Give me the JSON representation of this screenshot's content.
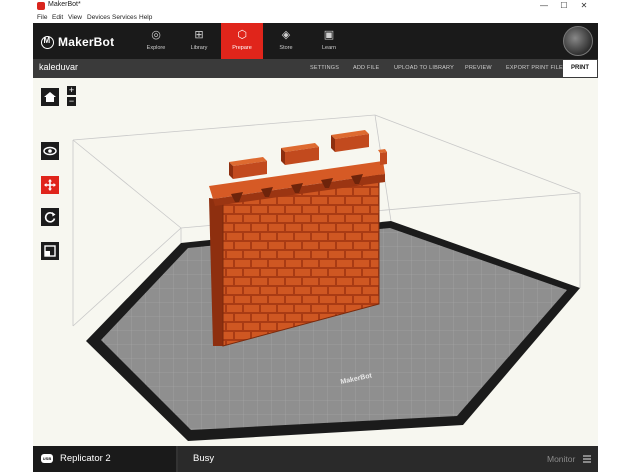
{
  "window": {
    "title": "MakerBot*",
    "controls": [
      "—",
      "☐",
      "✕"
    ]
  },
  "menu": [
    "File",
    "Edit",
    "View",
    "Devices",
    "Services",
    "Help"
  ],
  "nav": {
    "brand": "MakerBot",
    "tabs": [
      {
        "label": "Explore",
        "icon": "compass-icon",
        "glyph": "◎",
        "active": false
      },
      {
        "label": "Library",
        "icon": "library-icon",
        "glyph": "⊞",
        "active": false
      },
      {
        "label": "Prepare",
        "icon": "prepare-icon",
        "glyph": "⬡",
        "active": true
      },
      {
        "label": "Store",
        "icon": "store-icon",
        "glyph": "◈",
        "active": false
      },
      {
        "label": "Learn",
        "icon": "learn-icon",
        "glyph": "▣",
        "active": false
      }
    ]
  },
  "filebar": {
    "filename": "kaleduvar",
    "actions": [
      "SETTINGS",
      "ADD FILE",
      "UPLOAD TO LIBRARY",
      "PREVIEW",
      "EXPORT PRINT FILE"
    ],
    "print": "PRINT"
  },
  "viewport": {
    "plate_brand": "MakerBot",
    "zoom_in": "+",
    "zoom_out": "−",
    "tools": [
      "home-view-icon",
      "look-icon",
      "move-icon",
      "rotate-icon",
      "scale-icon"
    ],
    "active_tool": "move-icon"
  },
  "statusbar": {
    "connection": "USB",
    "printer": "Replicator 2",
    "status": "Busy",
    "monitor": "Monitor"
  },
  "colors": {
    "accent": "#e0251b",
    "model": "#c24a1e",
    "bar_dark": "#1a1a1a",
    "file_bar": "#3a3a3a",
    "plate": "#8f8f8f",
    "viewport_bg": "#f7f7f0"
  }
}
